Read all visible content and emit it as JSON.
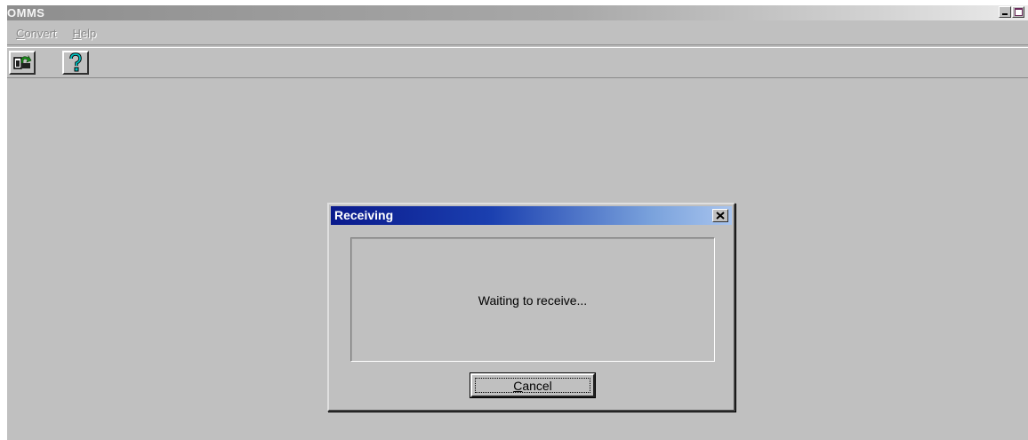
{
  "window": {
    "title": "OMMS"
  },
  "menu": [
    {
      "label": "Convert",
      "accel": "C",
      "rest": "onvert"
    },
    {
      "label": "Help",
      "accel": "H",
      "rest": "elp"
    }
  ],
  "toolbar": {
    "buttons": [
      {
        "icon": "convert-icon"
      },
      {
        "icon": "help-icon"
      }
    ]
  },
  "dialog": {
    "title": "Receiving",
    "message": "Waiting to receive...",
    "cancel": {
      "label": "Cancel",
      "accel": "C",
      "rest": "ancel"
    }
  },
  "colors": {
    "face": "#c0c0c0",
    "dialog_title_start": "#0a1a8c",
    "dialog_title_end": "#a8c4ee"
  }
}
